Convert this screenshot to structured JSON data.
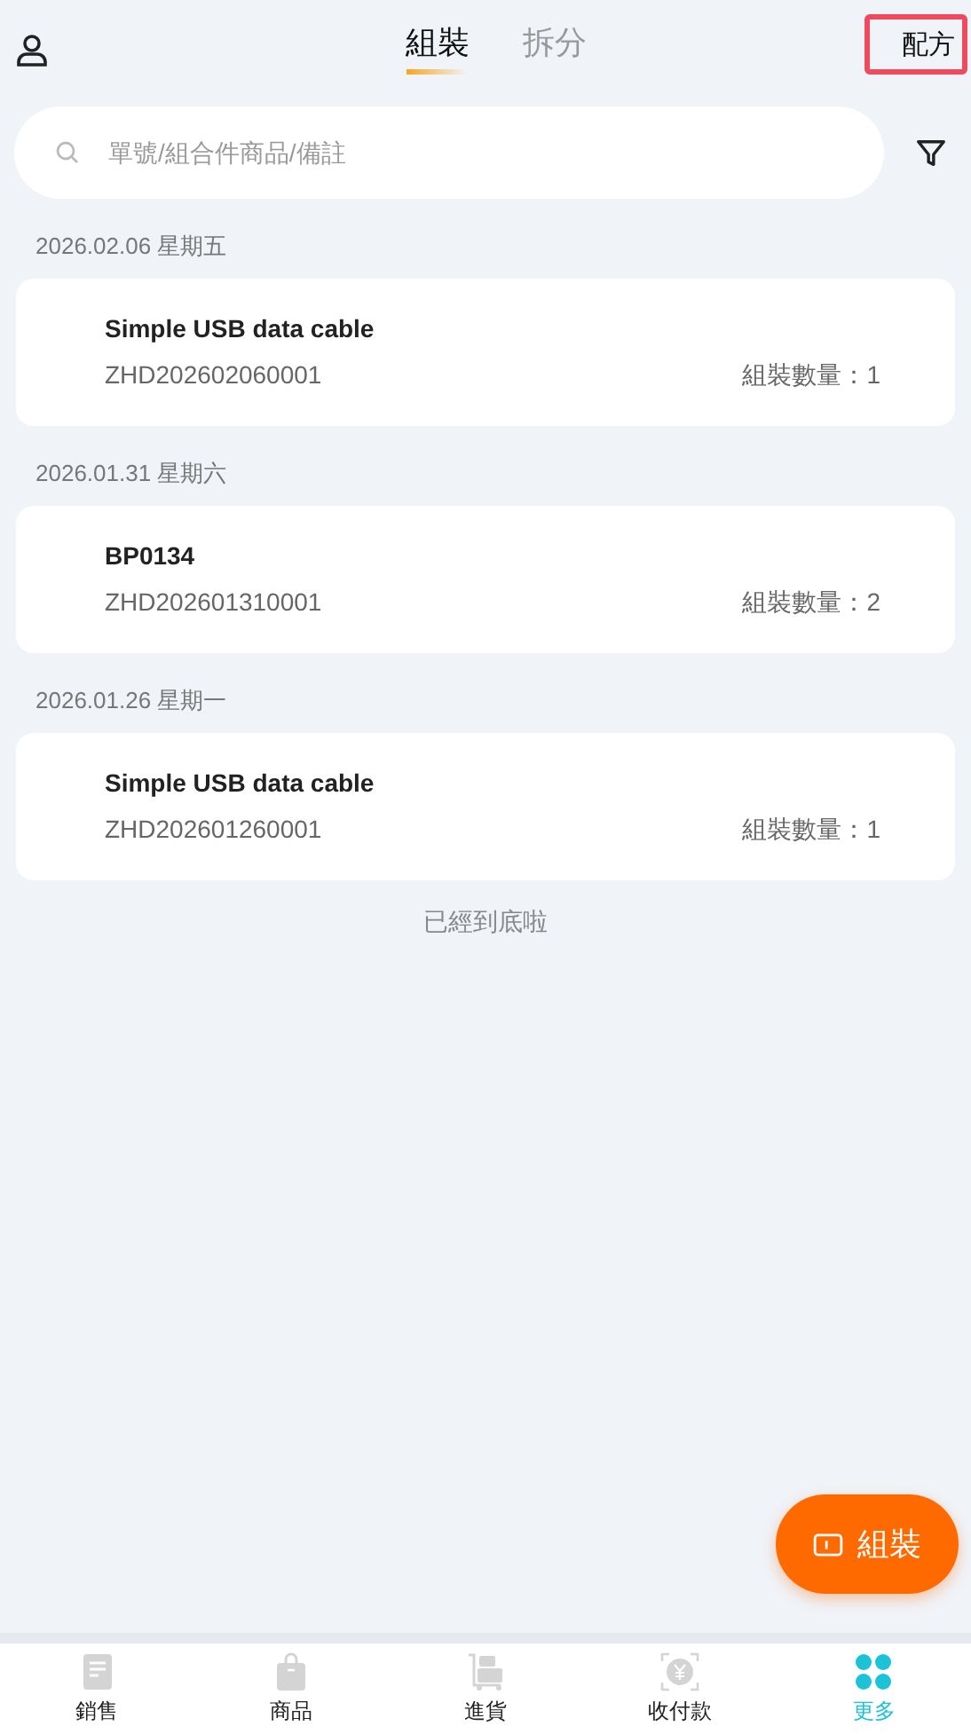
{
  "header": {
    "tabs": [
      {
        "label": "組裝",
        "selected": true
      },
      {
        "label": "拆分",
        "selected": false
      }
    ],
    "action": "配方"
  },
  "search": {
    "placeholder": "單號/組合件商品/備註"
  },
  "groups": [
    {
      "date": "2026.02.06 星期五",
      "orders": [
        {
          "name": "Simple USB data cable",
          "number": "ZHD202602060001",
          "quantity": "組裝數量：1"
        }
      ]
    },
    {
      "date": "2026.01.31 星期六",
      "orders": [
        {
          "name": "BP0134",
          "number": "ZHD202601310001",
          "quantity": "組裝數量：2"
        }
      ]
    },
    {
      "date": "2026.01.26 星期一",
      "orders": [
        {
          "name": "Simple USB data cable",
          "number": "ZHD202601260001",
          "quantity": "組裝數量：1"
        }
      ]
    }
  ],
  "end_note": "已經到底啦",
  "fab": "組裝",
  "bottom_nav": [
    {
      "label": "銷售",
      "kind": "doc",
      "selected": false
    },
    {
      "label": "商品",
      "kind": "bag",
      "selected": false
    },
    {
      "label": "進貨",
      "kind": "cart",
      "selected": false
    },
    {
      "label": "收付款",
      "kind": "coin",
      "selected": false
    },
    {
      "label": "更多",
      "kind": "clover",
      "selected": true
    }
  ]
}
